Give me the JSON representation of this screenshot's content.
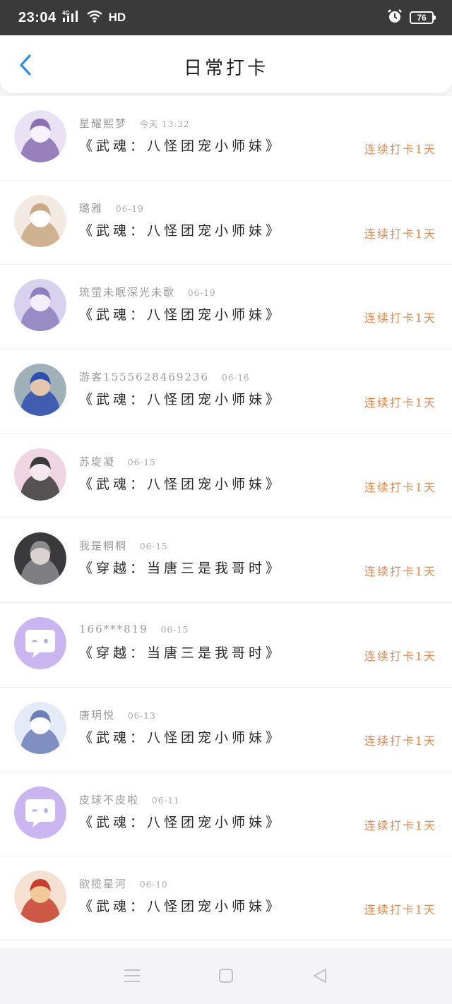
{
  "status_bar": {
    "time": "23:04",
    "network": "4G",
    "hd": "HD",
    "battery": "76",
    "icons": [
      "signal-icon",
      "wifi-icon",
      "alarm-icon",
      "battery-icon"
    ]
  },
  "header": {
    "title": "日常打卡",
    "back_icon": "chevron-left-icon",
    "accent_color": "#2a8ee8"
  },
  "checkins": [
    {
      "user": "星耀熙梦",
      "time": "今天 13:32",
      "book": "《武魂：八怪团宠小师妹》",
      "streak": "连续打卡1天",
      "avatar": "anime-avatar-purple"
    },
    {
      "user": "璐雅",
      "time": "06-19",
      "book": "《武魂：八怪团宠小师妹》",
      "streak": "连续打卡1天",
      "avatar": "anime-avatar-gold"
    },
    {
      "user": "琉萤未眠深光未歇",
      "time": "06-19",
      "book": "《武魂：八怪团宠小师妹》",
      "streak": "连续打卡1天",
      "avatar": "anime-avatar-lilac"
    },
    {
      "user": "游客1555628469236",
      "time": "06-16",
      "book": "《武魂：八怪团宠小师妹》",
      "streak": "连续打卡1天",
      "avatar": "photo-avatar-boy"
    },
    {
      "user": "苏琁凝",
      "time": "06-15",
      "book": "《武魂：八怪团宠小师妹》",
      "streak": "连续打卡1天",
      "avatar": "anime-avatar-pink"
    },
    {
      "user": "我是桐桐",
      "time": "06-15",
      "book": "《穿越：当唐三是我哥时》",
      "streak": "连续打卡1天",
      "avatar": "anime-avatar-dark"
    },
    {
      "user": "166***819",
      "time": "06-15",
      "book": "《穿越：当唐三是我哥时》",
      "streak": "连续打卡1天",
      "avatar": "default-chat-avatar"
    },
    {
      "user": "唐玥悦",
      "time": "06-13",
      "book": "《武魂：八怪团宠小师妹》",
      "streak": "连续打卡1天",
      "avatar": "anime-avatar-blue"
    },
    {
      "user": "皮球不皮啦",
      "time": "06-11",
      "book": "《武魂：八怪团宠小师妹》",
      "streak": "连续打卡1天",
      "avatar": "default-chat-avatar"
    },
    {
      "user": "欲揽星河",
      "time": "06-10",
      "book": "《武魂：八怪团宠小师妹》",
      "streak": "连续打卡1天",
      "avatar": "anime-avatar-red"
    }
  ],
  "colors": {
    "streak": "#e8874a",
    "username": "#9a9a9a",
    "default_avatar_bg": "#c9b6f0"
  },
  "nav_bar": {
    "icons": [
      "menu-icon",
      "home-square-icon",
      "back-triangle-icon"
    ]
  }
}
